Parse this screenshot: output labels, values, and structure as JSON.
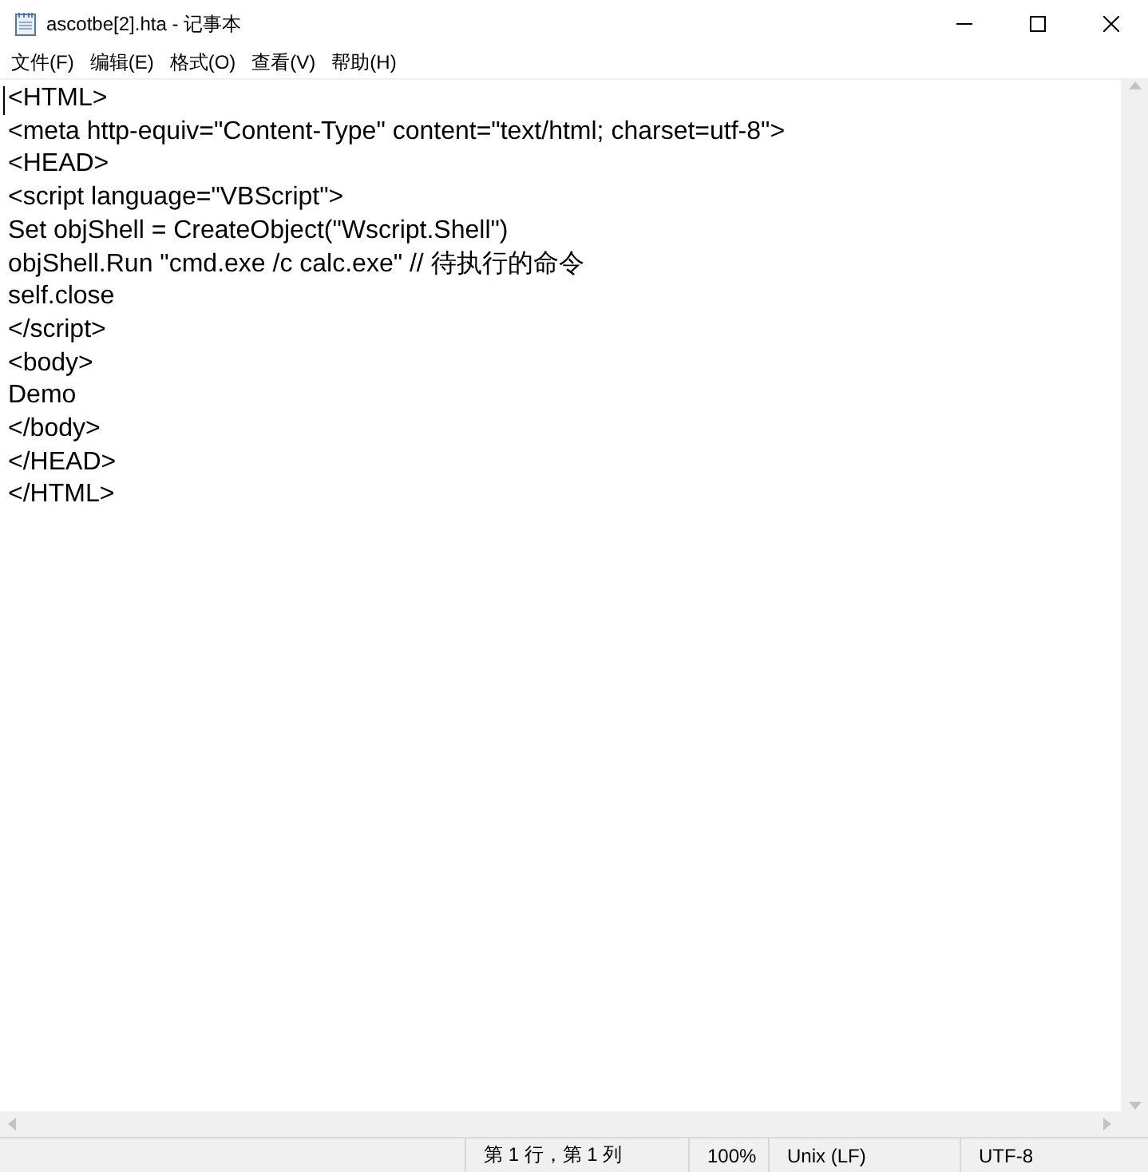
{
  "window": {
    "title": "ascotbe[2].hta - 记事本"
  },
  "menu": [
    "文件(F)",
    "编辑(E)",
    "格式(O)",
    "查看(V)",
    "帮助(H)"
  ],
  "editor": {
    "lines": [
      "<HTML>",
      "<meta http-equiv=\"Content-Type\" content=\"text/html; charset=utf-8\">",
      "<HEAD>",
      "<script language=\"VBScript\">",
      "Set objShell = CreateObject(\"Wscript.Shell\")",
      "objShell.Run \"cmd.exe /c calc.exe\" // 待执行的命令",
      "self.close",
      "</script>",
      "<body>",
      "Demo",
      "</body>",
      "</HEAD>",
      "</HTML>"
    ]
  },
  "status_bar": {
    "position": "第 1 行，第 1 列",
    "zoom": "100%",
    "line_ending": "Unix (LF)",
    "encoding": "UTF-8"
  }
}
